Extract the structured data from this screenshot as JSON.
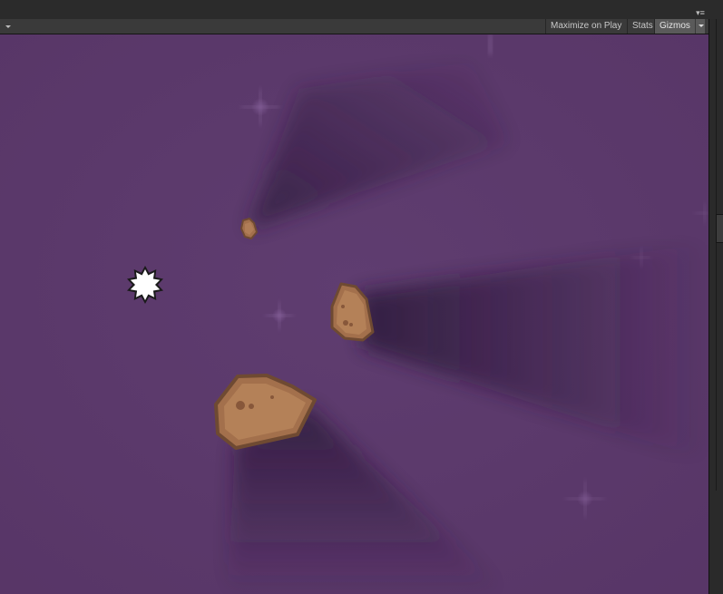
{
  "toolbar": {
    "maximize_label": "Maximize on Play",
    "stats_label": "Stats",
    "gizmos_label": "Gizmos"
  },
  "icons": {
    "panel_menu": "panel-menu-icon",
    "dropdown": "chevron-down-icon"
  },
  "colors": {
    "background": "#5b3a6b",
    "shadow": "#2e1a3c",
    "asteroid_fill": "#a3704c",
    "asteroid_outline": "#6f4a32",
    "asteroid_spot": "#87573a",
    "player": "#ffffff"
  },
  "scene": {
    "asteroid_count": 3,
    "player_icon": "starburst-player-icon",
    "sparkle_icon": "sparkle-star-icon"
  }
}
